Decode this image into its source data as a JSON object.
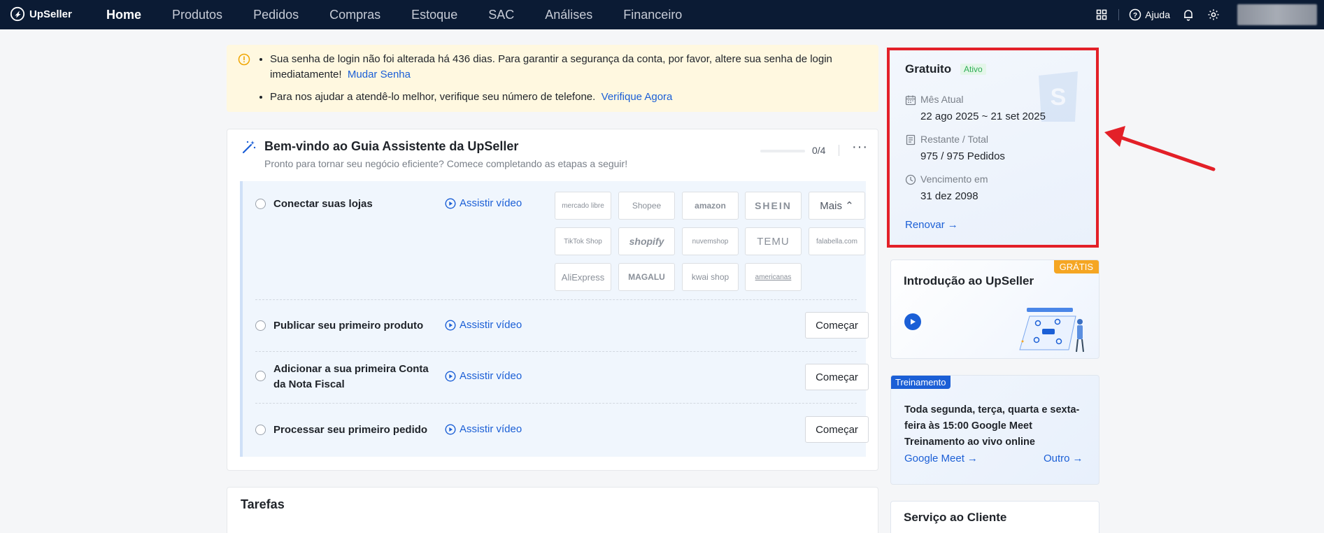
{
  "brand": {
    "name": "UpSeller"
  },
  "nav": {
    "items": [
      "Home",
      "Produtos",
      "Pedidos",
      "Compras",
      "Estoque",
      "SAC",
      "Análises",
      "Financeiro"
    ],
    "active": "Home"
  },
  "topbar": {
    "help_label": "Ajuda"
  },
  "alert": {
    "line1_text": "Sua senha de login não foi alterada há 436 dias. Para garantir a segurança da conta, por favor, altere sua senha de login imediatamente!",
    "line1_link": "Mudar Senha",
    "line2_text": "Para nos ajudar a atendê-lo melhor, verifique seu número de telefone.",
    "line2_link": "Verifique Agora"
  },
  "guide": {
    "title": "Bem-vindo ao Guia Assistente da UpSeller",
    "subtitle": "Pronto para tornar seu negócio eficiente? Comece completando as etapas a seguir!",
    "progress": "0/4",
    "progress_fraction": 0,
    "more": "···",
    "video_label": "Assistir vídeo",
    "start_label": "Começar",
    "steps": [
      {
        "label": "Conectar suas lojas"
      },
      {
        "label": "Publicar seu primeiro produto"
      },
      {
        "label": "Adicionar a sua primeira Conta da Nota Fiscal"
      },
      {
        "label": "Processar seu primeiro pedido"
      }
    ],
    "stores": [
      "mercado libre",
      "Shopee",
      "amazon",
      "SHEIN",
      "Mais",
      "TikTok Shop",
      "shopify",
      "nuvemshop",
      "TEMU",
      "falabella.com",
      "AliExpress",
      "MAGALU",
      "kwai shop",
      "americanas"
    ]
  },
  "tasks": {
    "title": "Tarefas"
  },
  "plan": {
    "title": "Gratuito",
    "badge": "Ativo",
    "month_label": "Mês Atual",
    "month_value": "22 ago 2025 ~ 21 set 2025",
    "remaining_label": "Restante / Total",
    "remaining_value": "975 / 975 Pedidos",
    "expiry_label": "Vencimento em",
    "expiry_value": "31 dez 2098",
    "renew": "Renovar"
  },
  "intro": {
    "badge": "GRÁTIS",
    "title": "Introdução ao UpSeller"
  },
  "training": {
    "badge": "Treinamento",
    "text": "Toda segunda, terça, quarta e sexta-feira às 15:00 Google Meet Treinamento ao vivo online",
    "link1": "Google Meet",
    "link2": "Outro"
  },
  "service": {
    "title": "Serviço ao Cliente"
  },
  "colors": {
    "nav_bg": "#0b1b34",
    "accent": "#1b5fd6",
    "highlight": "#e32028",
    "alert_bg": "#fff8e0"
  }
}
